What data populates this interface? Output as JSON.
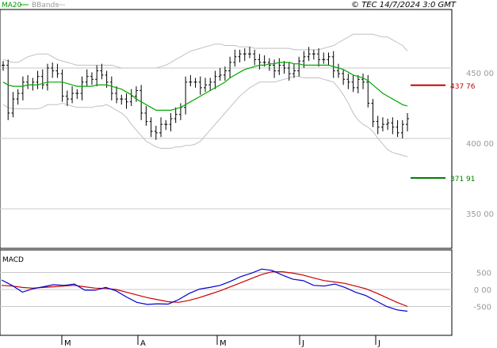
{
  "header": {
    "legend_ma": "MA20",
    "legend_bb": "BBands",
    "copyright": "© TEC 14/7/2024 3:0 GMT"
  },
  "price_panel": {
    "y_ticks": [
      "450 00",
      "400 00",
      "350 00"
    ],
    "levels": [
      {
        "value": 437.76,
        "label": "437 76",
        "color": "#cc0000"
      },
      {
        "value": 371.91,
        "label": "371 91",
        "color": "#008000"
      }
    ]
  },
  "macd_panel": {
    "title": "MACD",
    "y_ticks": [
      "500",
      "0 00",
      "-500"
    ]
  },
  "x_axis": {
    "months": [
      "M",
      "A",
      "M",
      "J",
      "J"
    ]
  },
  "colors": {
    "ma": "#00aa00",
    "bb": "#c0c0c0",
    "bars": "#000000",
    "macd": "#0000cc",
    "signal": "#cc0000",
    "grid": "#c8c8c8"
  },
  "chart_data": [
    {
      "type": "ohlc",
      "title": "",
      "ylim": [
        320,
        480
      ],
      "close": [
        452,
        418,
        428,
        432,
        440,
        438,
        440,
        444,
        438,
        450,
        448,
        446,
        430,
        428,
        432,
        432,
        440,
        444,
        442,
        448,
        445,
        440,
        432,
        428,
        428,
        426,
        430,
        434,
        418,
        412,
        405,
        404,
        410,
        410,
        414,
        417,
        422,
        440,
        440,
        440,
        436,
        438,
        440,
        444,
        445,
        448,
        454,
        458,
        460,
        460,
        460,
        456,
        454,
        454,
        452,
        448,
        452,
        450,
        446,
        448,
        455,
        458,
        460,
        460,
        456,
        456,
        458,
        448,
        446,
        442,
        440,
        436,
        442,
        440,
        425,
        412,
        408,
        410,
        411,
        408,
        404,
        410,
        414
      ],
      "ma20": [
        440,
        438,
        437,
        437,
        437,
        438,
        438,
        438,
        439,
        440,
        440,
        440,
        440,
        439,
        438,
        437,
        437,
        437,
        437,
        438,
        438,
        438,
        437,
        436,
        435,
        433,
        431,
        428,
        426,
        424,
        422,
        420,
        420,
        420,
        420,
        421,
        422,
        424,
        426,
        428,
        430,
        432,
        434,
        436,
        438,
        440,
        443,
        445,
        447,
        449,
        450,
        451,
        452,
        452,
        453,
        453,
        454,
        454,
        454,
        453,
        453,
        452,
        452,
        452,
        452,
        452,
        452,
        451,
        450,
        449,
        447,
        445,
        444,
        443,
        441,
        438,
        435,
        432,
        430,
        428,
        426,
        424,
        423
      ],
      "bb_upper": [
        456,
        455,
        454,
        454,
        456,
        458,
        459,
        460,
        460,
        460,
        458,
        456,
        455,
        454,
        453,
        452,
        452,
        452,
        452,
        452,
        452,
        452,
        452,
        451,
        450,
        450,
        450,
        450,
        450,
        450,
        450,
        450,
        451,
        452,
        454,
        456,
        458,
        460,
        462,
        463,
        464,
        465,
        466,
        467,
        467,
        466,
        466,
        466,
        465,
        465,
        465,
        464,
        464,
        464,
        464,
        464,
        464,
        464,
        464,
        463,
        463,
        463,
        463,
        463,
        463,
        464,
        465,
        466,
        468,
        470,
        472,
        474,
        474,
        474,
        474,
        474,
        473,
        472,
        472,
        470,
        468,
        466,
        462
      ],
      "bb_lower": [
        424,
        422,
        421,
        421,
        421,
        421,
        421,
        421,
        422,
        424,
        424,
        424,
        425,
        424,
        423,
        422,
        422,
        422,
        422,
        423,
        423,
        424,
        422,
        420,
        418,
        415,
        410,
        406,
        402,
        398,
        396,
        394,
        393,
        393,
        393,
        394,
        394,
        395,
        395,
        396,
        398,
        402,
        406,
        410,
        414,
        418,
        422,
        426,
        430,
        433,
        436,
        438,
        440,
        440,
        440,
        440,
        441,
        442,
        443,
        444,
        444,
        443,
        443,
        443,
        443,
        442,
        441,
        440,
        436,
        431,
        425,
        418,
        413,
        410,
        408,
        405,
        400,
        396,
        392,
        390,
        389,
        388,
        387
      ],
      "levels": [
        437.76,
        371.91
      ]
    },
    {
      "type": "line",
      "title": "MACD",
      "ylim": [
        -900,
        900
      ],
      "series": [
        {
          "name": "MACD",
          "values": [
            280,
            120,
            -80,
            20,
            80,
            140,
            120,
            160,
            -20,
            -20,
            60,
            -40,
            -220,
            -380,
            -440,
            -420,
            -430,
            -300,
            -120,
            10,
            60,
            120,
            240,
            380,
            480,
            600,
            560,
            420,
            300,
            260,
            120,
            100,
            160,
            60,
            -80,
            -180,
            -340,
            -500,
            -600,
            -640
          ]
        },
        {
          "name": "Signal",
          "values": [
            120,
            100,
            60,
            40,
            60,
            80,
            100,
            120,
            80,
            40,
            30,
            0,
            -80,
            -160,
            -240,
            -300,
            -360,
            -380,
            -320,
            -240,
            -140,
            -40,
            80,
            200,
            320,
            440,
            520,
            520,
            480,
            420,
            340,
            260,
            220,
            180,
            100,
            20,
            -100,
            -240,
            -380,
            -500
          ]
        }
      ]
    }
  ]
}
